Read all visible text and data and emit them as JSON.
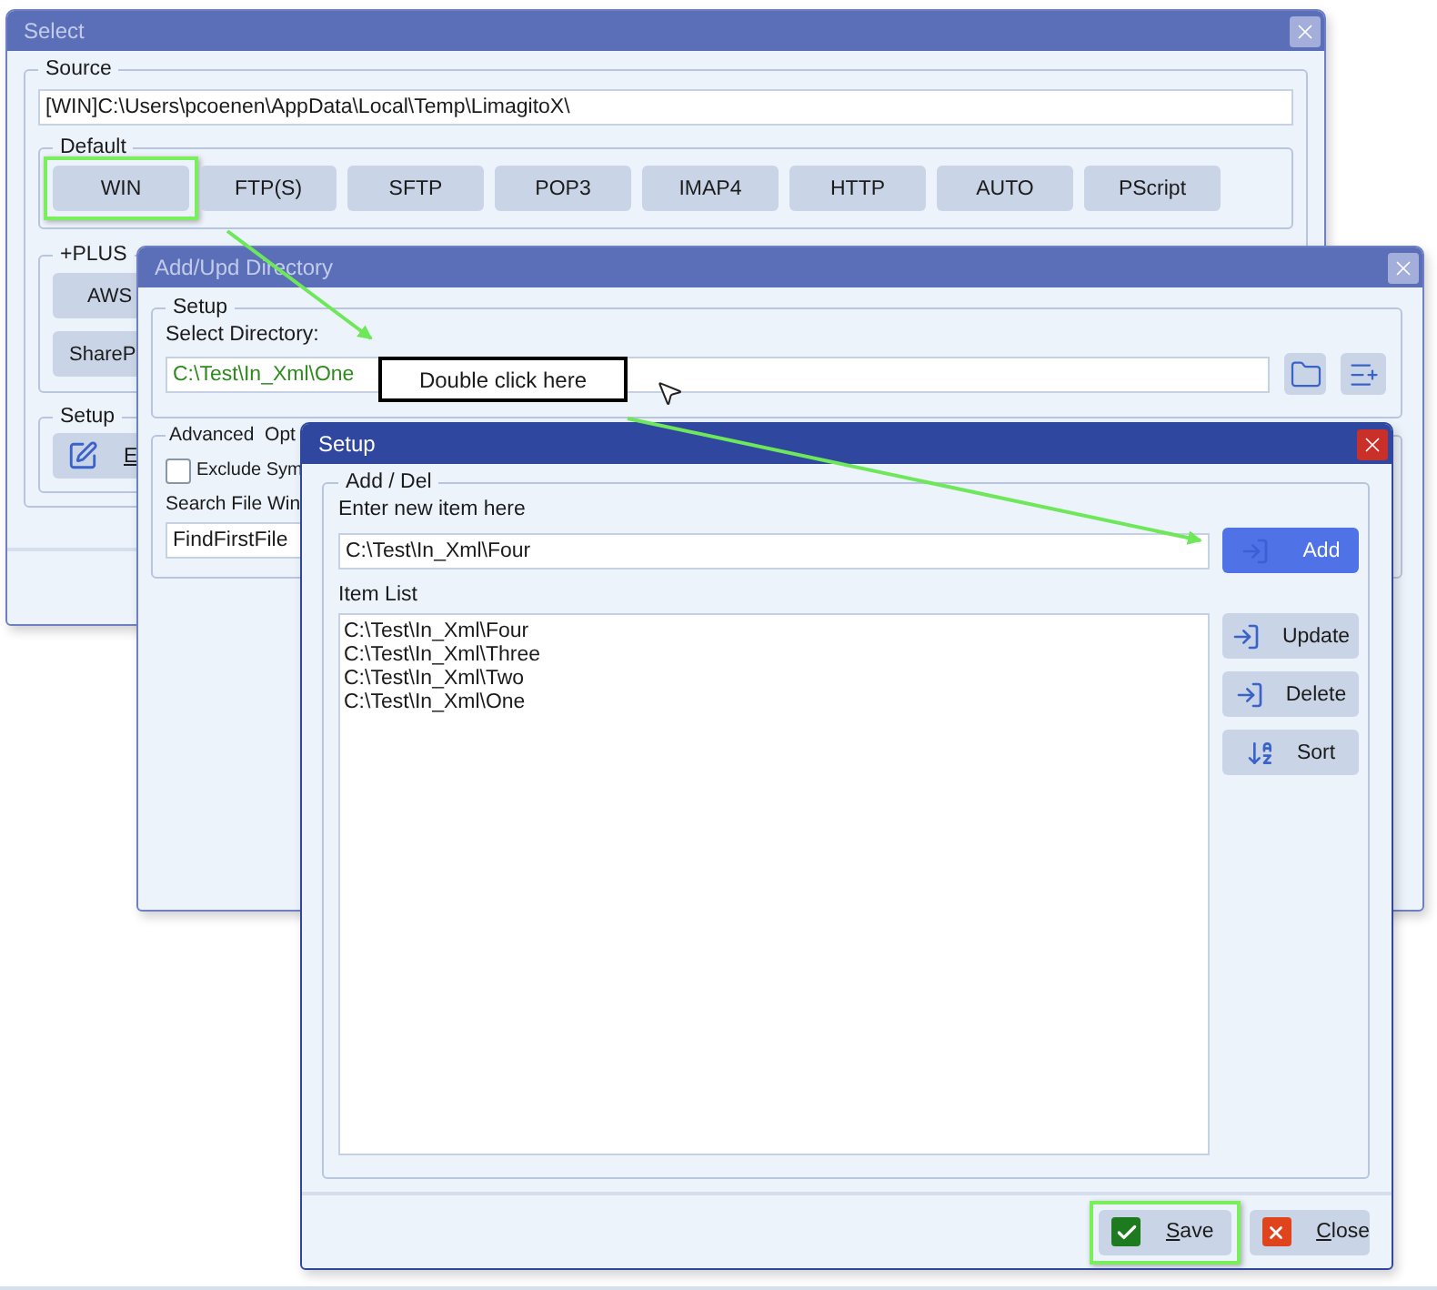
{
  "select_window": {
    "title": "Select",
    "active": false,
    "source": {
      "label": "Source",
      "value": "[WIN]C:\\Users\\pcoenen\\AppData\\Local\\Temp\\LimagitoX\\"
    },
    "default_group": {
      "label": "Default",
      "buttons": [
        {
          "label": "WIN",
          "highlighted": true
        },
        {
          "label": "FTP(S)",
          "highlighted": false
        },
        {
          "label": "SFTP",
          "highlighted": false
        },
        {
          "label": "POP3",
          "highlighted": false
        },
        {
          "label": "IMAP4",
          "highlighted": false
        },
        {
          "label": "HTTP",
          "highlighted": false
        },
        {
          "label": "AUTO",
          "highlighted": false
        },
        {
          "label": "PScript",
          "highlighted": false
        }
      ]
    },
    "plus_group": {
      "label": "+PLUS",
      "buttons": [
        "AWS",
        "ShareP"
      ]
    },
    "setup_group": {
      "label": "Setup",
      "button_label": "E"
    }
  },
  "add_upd_window": {
    "title": "Add/Upd Directory",
    "active": false,
    "setup_group": {
      "label": "Setup",
      "field_label": "Select Directory:",
      "value": "C:\\Test\\In_Xml\\One"
    },
    "advanced_group": {
      "label": "Advanced  Opt",
      "checkbox": {
        "label": "Exclude Sym",
        "checked": false
      },
      "search_label": "Search File Win",
      "search_value": "FindFirstFile"
    }
  },
  "callout": "Double click here",
  "setup_window": {
    "title": "Setup",
    "active": true,
    "group_label": "Add / Del",
    "entry_label": "Enter new item here",
    "entry_value": "C:\\Test\\In_Xml\\Four",
    "add_button": "Add",
    "list_label": "Item List",
    "items": [
      "C:\\Test\\In_Xml\\Four",
      "C:\\Test\\In_Xml\\Three",
      "C:\\Test\\In_Xml\\Two",
      "C:\\Test\\In_Xml\\One"
    ],
    "side_buttons": [
      {
        "kind": "update",
        "label": "Update"
      },
      {
        "kind": "delete",
        "label": "Delete"
      },
      {
        "kind": "sort",
        "label": "Sort"
      }
    ],
    "footer_buttons": [
      {
        "kind": "save",
        "label": "Save",
        "highlighted": true
      },
      {
        "kind": "close",
        "label": "Close",
        "highlighted": false
      }
    ]
  }
}
